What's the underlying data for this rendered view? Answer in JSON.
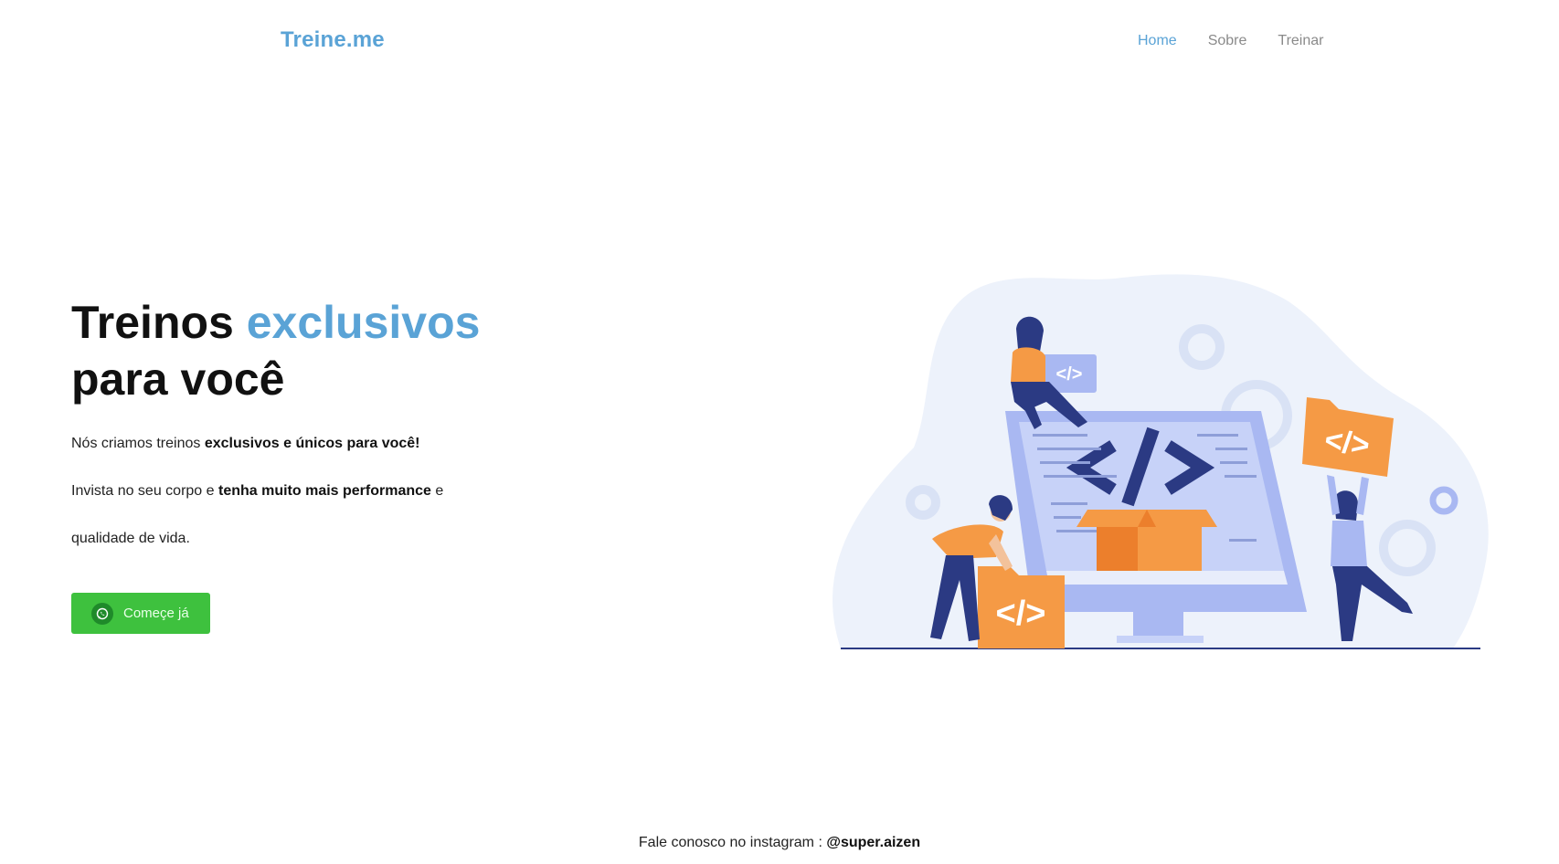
{
  "header": {
    "logo": "Treine.me",
    "nav": [
      {
        "label": "Home",
        "active": true
      },
      {
        "label": "Sobre",
        "active": false
      },
      {
        "label": "Treinar",
        "active": false
      }
    ]
  },
  "hero": {
    "title_part1": "Treinos ",
    "title_accent": "exclusivos",
    "title_part2": "para você",
    "line1_prefix": "Nós criamos treinos ",
    "line1_bold": "exclusivos e únicos para você!",
    "line2_prefix": "Invista no seu corpo e ",
    "line2_bold": "tenha muito mais performance",
    "line2_suffix": " e",
    "line3": "qualidade de vida.",
    "cta_label": "Começe já",
    "cta_icon": "whatsapp-icon"
  },
  "illustration": {
    "code_symbol": "</>",
    "icon": "developers-illustration"
  },
  "footer": {
    "prefix": "Fale conosco no instagram : ",
    "handle": "@super.aizen"
  },
  "colors": {
    "accent": "#5aa3d6",
    "cta_green": "#3ec13e",
    "orange": "#f59a45",
    "navy": "#2b3a83",
    "lavender": "#a9b8f2"
  }
}
